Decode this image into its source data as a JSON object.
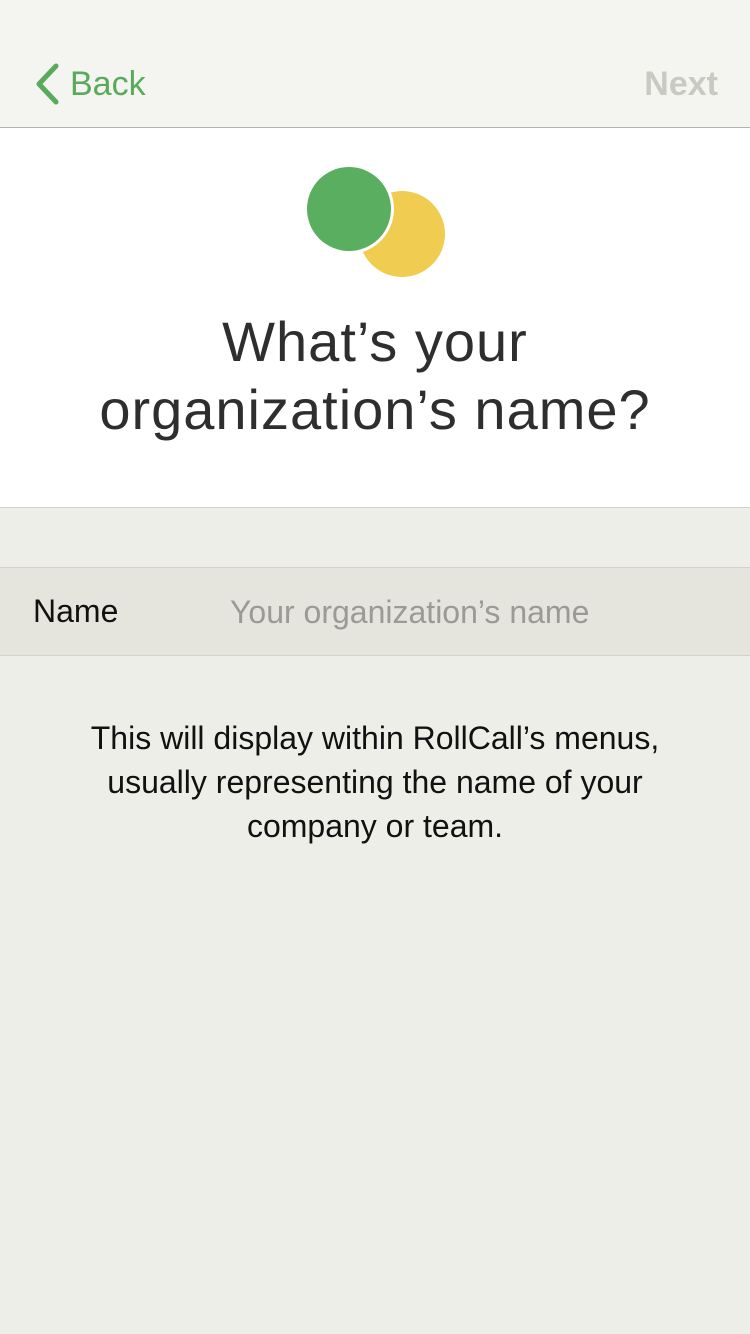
{
  "navbar": {
    "back_label": "Back",
    "next_label": "Next"
  },
  "header": {
    "title_line1": "What’s your",
    "title_line2": "organization’s name?"
  },
  "form": {
    "name_label": "Name",
    "name_placeholder": "Your organization’s name",
    "name_value": ""
  },
  "helper": {
    "line1": "This will display within RollCall’s menus,",
    "line2": "usually representing the name of your",
    "line3": "company or team."
  },
  "colors": {
    "accent_green": "#5aaa5c",
    "logo_green": "#5aae60",
    "logo_yellow": "#f0cc50",
    "disabled_gray": "#c9c9c4"
  },
  "icons": {
    "back": "chevron-left-icon",
    "logo": "rollcall-logo-icon"
  }
}
